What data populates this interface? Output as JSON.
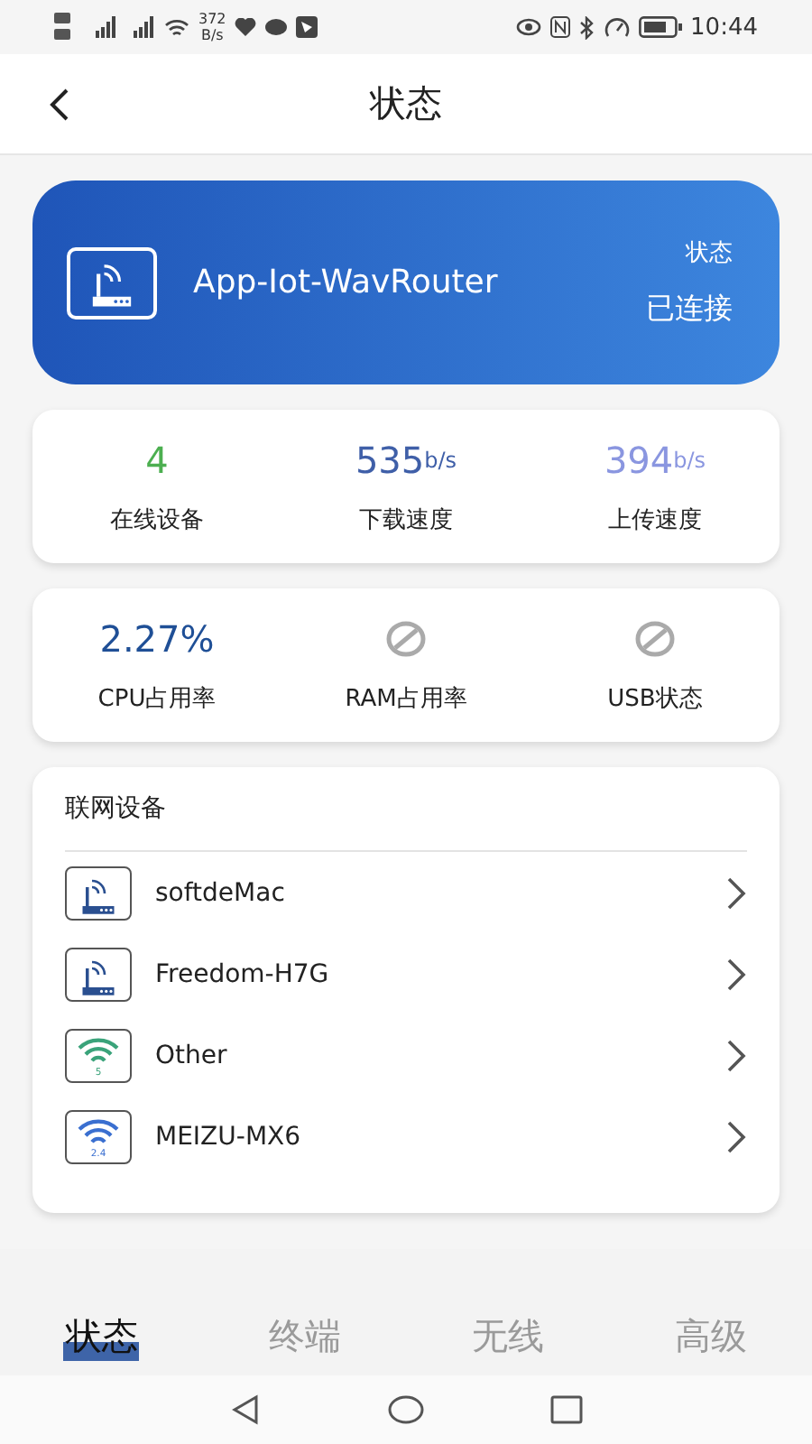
{
  "status_bar": {
    "speed": "372",
    "speed_unit": "B/s",
    "time": "10:44"
  },
  "header": {
    "title": "状态"
  },
  "router": {
    "name": "App-Iot-WavRouter",
    "status_label": "状态",
    "status": "已连接"
  },
  "stats": [
    {
      "value": "4",
      "label": "在线设备",
      "color": "#4caf50"
    },
    {
      "value": "535",
      "unit": "b/s",
      "label": "下载速度",
      "color": "#3f5fa8"
    },
    {
      "value": "394",
      "unit": "b/s",
      "label": "上传速度",
      "color": "#8a96e0"
    }
  ],
  "system": [
    {
      "kind": "value",
      "value": "2.27%",
      "label": "CPU占用率"
    },
    {
      "kind": "unavailable",
      "label": "RAM占用率"
    },
    {
      "kind": "unavailable",
      "label": "USB状态"
    }
  ],
  "devices": {
    "title": "联网设备",
    "items": [
      {
        "kind": "router",
        "name": "softdeMac"
      },
      {
        "kind": "router",
        "name": "Freedom-H7G"
      },
      {
        "kind": "wifi",
        "band": "5",
        "color": "#3aa37a",
        "name": "Other"
      },
      {
        "kind": "wifi",
        "band": "2.4",
        "color": "#3a6fd0",
        "name": "MEIZU-MX6"
      }
    ]
  },
  "tabs": [
    {
      "label": "状态",
      "selected": true
    },
    {
      "label": "终端",
      "selected": false
    },
    {
      "label": "无线",
      "selected": false
    },
    {
      "label": "高级",
      "selected": false
    }
  ]
}
